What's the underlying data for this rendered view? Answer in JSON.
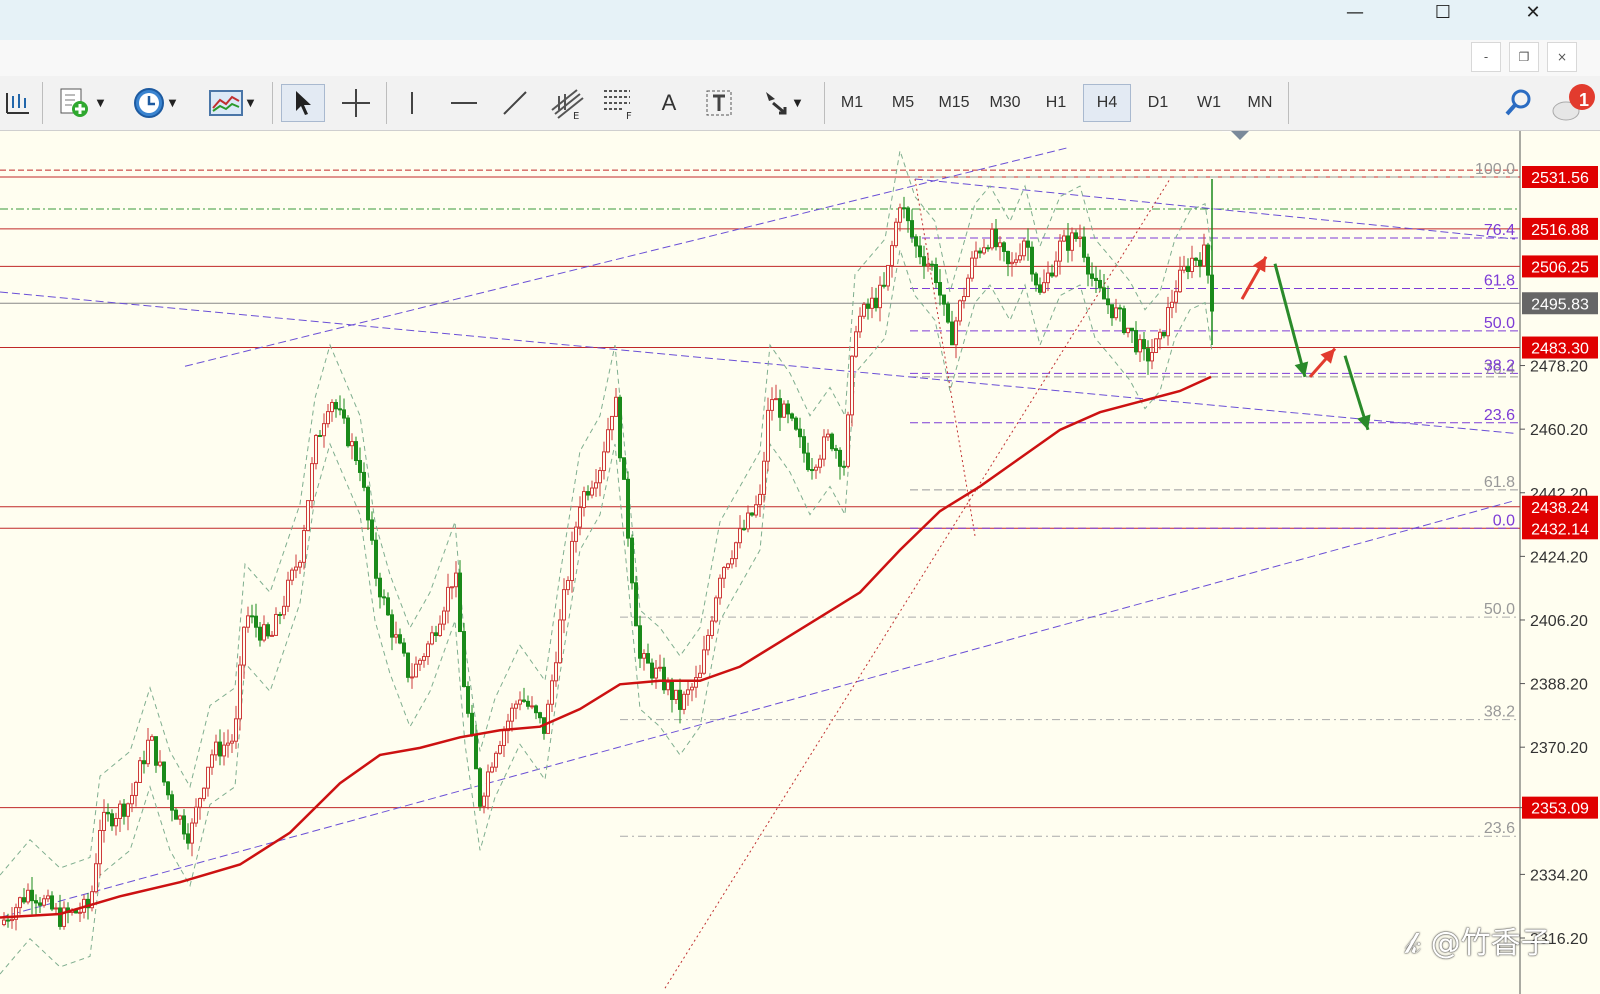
{
  "window": {
    "minimize": "—",
    "maximize": "☐",
    "close": "✕"
  },
  "mdi": {
    "minimize": "-",
    "restore": "❐",
    "close": "×"
  },
  "toolbar": {
    "timeframes": [
      "M1",
      "M5",
      "M15",
      "M30",
      "H1",
      "H4",
      "D1",
      "W1",
      "MN"
    ],
    "active_timeframe": "H4",
    "text_tool": "A",
    "label_tool": "T",
    "notification_count": "1",
    "icons": [
      "chart-properties-icon",
      "new-chart-icon",
      "clock-icon",
      "indicators-icon",
      "cursor-icon",
      "crosshair-icon",
      "vertical-line-icon",
      "horizontal-line-icon",
      "trendline-icon",
      "fibonacci-icon",
      "fibo-fan-icon",
      "text-tool-icon",
      "text-label-icon",
      "arrows-tool-icon",
      "search-icon",
      "notifications-icon"
    ]
  },
  "chart_data": {
    "type": "candlestick",
    "symbol_colors": {
      "bull": "#ce3a3a",
      "bear": "#1a8a1a",
      "ma": "#cc1111"
    },
    "price_axis": {
      "ylim": [
        2310,
        2540
      ],
      "ticks": [
        "2316.20",
        "2334.20",
        "2353.09",
        "2370.20",
        "2388.20",
        "2406.20",
        "2424.20",
        "2442.20",
        "2460.20",
        "2478.20"
      ]
    },
    "price_labels": [
      {
        "value": 2531.56,
        "text": "2531.56",
        "color": "#e00000"
      },
      {
        "value": 2516.88,
        "text": "2516.88",
        "color": "#e00000"
      },
      {
        "value": 2506.25,
        "text": "2506.25",
        "color": "#e00000"
      },
      {
        "value": 2495.83,
        "text": "2495.83",
        "color": "#666666"
      },
      {
        "value": 2483.3,
        "text": "2483.30",
        "color": "#e00000"
      },
      {
        "value": 2438.24,
        "text": "2438.24",
        "color": "#e00000"
      },
      {
        "value": 2432.14,
        "text": "2432.14",
        "color": "#e00000"
      },
      {
        "value": 2353.09,
        "text": "2353.09",
        "color": "#e00000"
      }
    ],
    "fib_upper": [
      {
        "text": "100.0",
        "value": 2531.56,
        "color": "#999999"
      },
      {
        "text": "76.4",
        "value": 2514.3,
        "color": "#7d3cd6"
      },
      {
        "text": "61.8",
        "value": 2500.0,
        "color": "#7d3cd6"
      },
      {
        "text": "50.0",
        "value": 2488.0,
        "color": "#7d3cd6"
      },
      {
        "text": "76.4",
        "value": 2475.0,
        "color": "#999999"
      },
      {
        "text": "38.2",
        "value": 2476.0,
        "color": "#7d3cd6"
      },
      {
        "text": "23.6",
        "value": 2462.0,
        "color": "#7d3cd6"
      },
      {
        "text": "61.8",
        "value": 2443.0,
        "color": "#999999"
      },
      {
        "text": "0.0",
        "value": 2432.14,
        "color": "#7d3cd6"
      }
    ],
    "fib_lower": [
      {
        "text": "50.0",
        "value": 2407.0,
        "color": "#999999"
      },
      {
        "text": "38.2",
        "value": 2378.0,
        "color": "#999999"
      },
      {
        "text": "23.6",
        "value": 2345.0,
        "color": "#999999"
      }
    ],
    "ma_points": [
      [
        0,
        2322
      ],
      [
        60,
        2323
      ],
      [
        120,
        2328
      ],
      [
        180,
        2332
      ],
      [
        240,
        2337
      ],
      [
        290,
        2346
      ],
      [
        340,
        2360
      ],
      [
        380,
        2368
      ],
      [
        420,
        2370
      ],
      [
        460,
        2373
      ],
      [
        500,
        2375
      ],
      [
        540,
        2376
      ],
      [
        580,
        2381
      ],
      [
        620,
        2388
      ],
      [
        660,
        2389
      ],
      [
        700,
        2389
      ],
      [
        740,
        2393
      ],
      [
        780,
        2400
      ],
      [
        820,
        2407
      ],
      [
        860,
        2414
      ],
      [
        900,
        2426
      ],
      [
        940,
        2437
      ],
      [
        980,
        2444
      ],
      [
        1020,
        2452
      ],
      [
        1060,
        2460
      ],
      [
        1100,
        2465
      ],
      [
        1140,
        2468
      ],
      [
        1180,
        2471
      ],
      [
        1211,
        2475
      ]
    ],
    "price_path": [
      [
        0,
        2320
      ],
      [
        30,
        2330
      ],
      [
        60,
        2322
      ],
      [
        90,
        2325
      ],
      [
        100,
        2348
      ],
      [
        130,
        2355
      ],
      [
        150,
        2373
      ],
      [
        170,
        2355
      ],
      [
        190,
        2345
      ],
      [
        210,
        2368
      ],
      [
        235,
        2373
      ],
      [
        245,
        2408
      ],
      [
        270,
        2400
      ],
      [
        300,
        2425
      ],
      [
        315,
        2455
      ],
      [
        330,
        2470
      ],
      [
        345,
        2460
      ],
      [
        360,
        2450
      ],
      [
        375,
        2420
      ],
      [
        390,
        2405
      ],
      [
        410,
        2390
      ],
      [
        430,
        2400
      ],
      [
        455,
        2420
      ],
      [
        465,
        2385
      ],
      [
        480,
        2355
      ],
      [
        495,
        2370
      ],
      [
        520,
        2385
      ],
      [
        545,
        2375
      ],
      [
        560,
        2405
      ],
      [
        580,
        2440
      ],
      [
        600,
        2450
      ],
      [
        615,
        2470
      ],
      [
        625,
        2440
      ],
      [
        640,
        2395
      ],
      [
        660,
        2390
      ],
      [
        680,
        2382
      ],
      [
        700,
        2390
      ],
      [
        720,
        2420
      ],
      [
        740,
        2430
      ],
      [
        760,
        2440
      ],
      [
        770,
        2470
      ],
      [
        790,
        2462
      ],
      [
        810,
        2450
      ],
      [
        830,
        2458
      ],
      [
        845,
        2450
      ],
      [
        855,
        2490
      ],
      [
        870,
        2495
      ],
      [
        885,
        2500
      ],
      [
        900,
        2525
      ],
      [
        915,
        2512
      ],
      [
        935,
        2505
      ],
      [
        950,
        2485
      ],
      [
        960,
        2495
      ],
      [
        975,
        2510
      ],
      [
        990,
        2515
      ],
      [
        1010,
        2505
      ],
      [
        1025,
        2515
      ],
      [
        1040,
        2498
      ],
      [
        1060,
        2512
      ],
      [
        1080,
        2515
      ],
      [
        1095,
        2500
      ],
      [
        1110,
        2495
      ],
      [
        1130,
        2488
      ],
      [
        1145,
        2480
      ],
      [
        1160,
        2485
      ],
      [
        1175,
        2500
      ],
      [
        1190,
        2508
      ],
      [
        1205,
        2510
      ],
      [
        1212,
        2496
      ]
    ]
  }
}
